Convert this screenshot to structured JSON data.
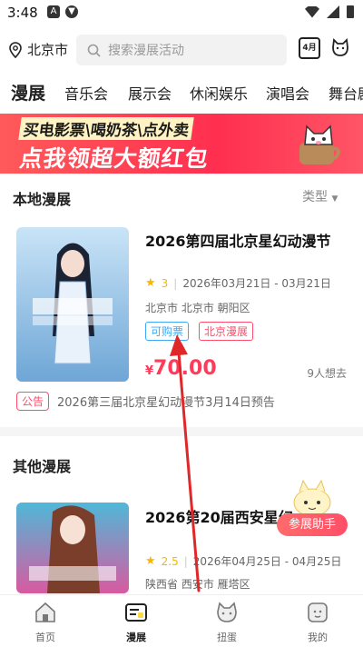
{
  "status_bar": {
    "time": "3:48"
  },
  "top_bar": {
    "location": "北京市",
    "search_placeholder": "搜索漫展活动",
    "calendar_label": "4月"
  },
  "category_tabs": [
    "漫展",
    "音乐会",
    "展示会",
    "休闲娱乐",
    "演唱会",
    "舞台剧"
  ],
  "banner": {
    "line1": "买电影票\\喝奶茶\\点外卖",
    "line2": "点我领超大额红包"
  },
  "local_section": {
    "title": "本地漫展",
    "filter_label": "类型"
  },
  "events": [
    {
      "title": "2026第四届北京星幻动漫节",
      "rating": "3",
      "dates": "2026年03月21日 - 03月21日",
      "address": "北京市 北京市 朝阳区",
      "tags": [
        "可购票",
        "北京漫展"
      ],
      "price_currency": "¥",
      "price": "70.00",
      "interest": "9人想去"
    }
  ],
  "notice": {
    "badge": "公告",
    "text": "2026第三届北京星幻动漫节3月14日预告"
  },
  "other_section": {
    "title": "其他漫展"
  },
  "other_events": [
    {
      "title": "2026第20届西安星幻",
      "rating": "2.5",
      "dates": "2026年04月25日 - 04月25日",
      "address": "陕西省 西安市 雁塔区"
    }
  ],
  "assistant_button": "参展助手",
  "bottom_nav": [
    {
      "label": "首页",
      "icon": "home-icon"
    },
    {
      "label": "漫展",
      "icon": "expo-icon"
    },
    {
      "label": "扭蛋",
      "icon": "capsule-cat-icon"
    },
    {
      "label": "我的",
      "icon": "profile-icon"
    }
  ],
  "colors": {
    "accent": "#ff3b5c",
    "tab_highlight": "#ffd84a",
    "tag_blue": "#3fa9f5"
  }
}
